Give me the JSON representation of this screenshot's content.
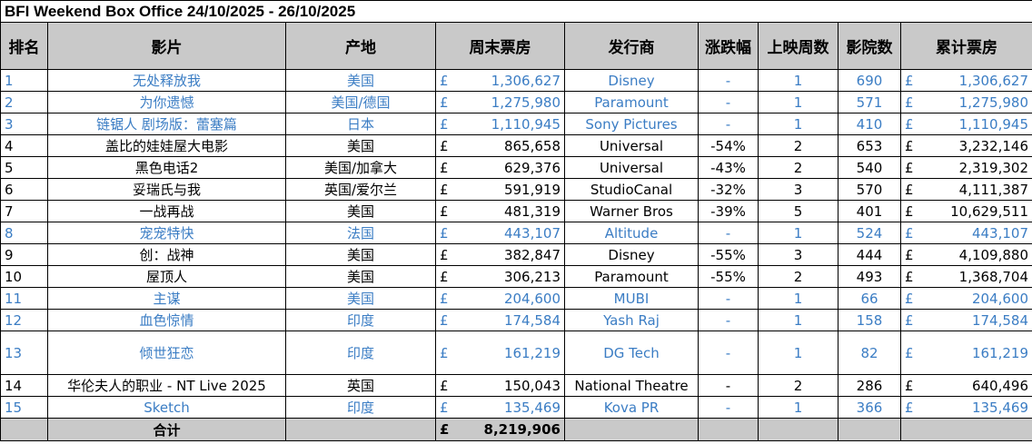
{
  "title": "BFI Weekend Box Office 24/10/2025 - 26/10/2025",
  "currency": "£",
  "headers": [
    "排名",
    "影片",
    "产地",
    "周末票房",
    "发行商",
    "涨跌幅",
    "上映周数",
    "影院数",
    "累计票房"
  ],
  "rows": [
    {
      "rank": "1",
      "film": "无处释放我",
      "origin": "美国",
      "weekend": "1,306,627",
      "distributor": "Disney",
      "change": "-",
      "weeks": "1",
      "cinemas": "690",
      "total": "1,306,627",
      "is_new": true
    },
    {
      "rank": "2",
      "film": "为你遗憾",
      "origin": "美国/德国",
      "weekend": "1,275,980",
      "distributor": "Paramount",
      "change": "-",
      "weeks": "1",
      "cinemas": "571",
      "total": "1,275,980",
      "is_new": true
    },
    {
      "rank": "3",
      "film": "链锯人 剧场版：蕾塞篇",
      "origin": "日本",
      "weekend": "1,110,945",
      "distributor": "Sony Pictures",
      "change": "-",
      "weeks": "1",
      "cinemas": "410",
      "total": "1,110,945",
      "is_new": true
    },
    {
      "rank": "4",
      "film": "盖比的娃娃屋大电影",
      "origin": "美国",
      "weekend": "865,658",
      "distributor": "Universal",
      "change": "-54%",
      "weeks": "2",
      "cinemas": "653",
      "total": "3,232,146",
      "is_new": false
    },
    {
      "rank": "5",
      "film": "黑色电话2",
      "origin": "美国/加拿大",
      "weekend": "629,376",
      "distributor": "Universal",
      "change": "-43%",
      "weeks": "2",
      "cinemas": "540",
      "total": "2,319,302",
      "is_new": false
    },
    {
      "rank": "6",
      "film": "妥瑞氏与我",
      "origin": "英国/爱尔兰",
      "weekend": "591,919",
      "distributor": "StudioCanal",
      "change": "-32%",
      "weeks": "3",
      "cinemas": "570",
      "total": "4,111,387",
      "is_new": false
    },
    {
      "rank": "7",
      "film": "一战再战",
      "origin": "美国",
      "weekend": "481,319",
      "distributor": "Warner Bros",
      "change": "-39%",
      "weeks": "5",
      "cinemas": "401",
      "total": "10,629,511",
      "is_new": false
    },
    {
      "rank": "8",
      "film": "宠宠特快",
      "origin": "法国",
      "weekend": "443,107",
      "distributor": "Altitude",
      "change": "-",
      "weeks": "1",
      "cinemas": "524",
      "total": "443,107",
      "is_new": true
    },
    {
      "rank": "9",
      "film": "创：战神",
      "origin": "美国",
      "weekend": "382,847",
      "distributor": "Disney",
      "change": "-55%",
      "weeks": "3",
      "cinemas": "444",
      "total": "4,109,880",
      "is_new": false
    },
    {
      "rank": "10",
      "film": "屋顶人",
      "origin": "美国",
      "weekend": "306,213",
      "distributor": "Paramount",
      "change": "-55%",
      "weeks": "2",
      "cinemas": "493",
      "total": "1,368,704",
      "is_new": false
    },
    {
      "rank": "11",
      "film": "主谋",
      "origin": "美国",
      "weekend": "204,600",
      "distributor": "MUBI",
      "change": "-",
      "weeks": "1",
      "cinemas": "66",
      "total": "204,600",
      "is_new": true
    },
    {
      "rank": "12",
      "film": "血色惊情",
      "origin": "印度",
      "weekend": "174,584",
      "distributor": "Yash Raj",
      "change": "-",
      "weeks": "1",
      "cinemas": "158",
      "total": "174,584",
      "is_new": true
    },
    {
      "rank": "13",
      "film": "倾世狂恋",
      "origin": "印度",
      "weekend": "161,219",
      "distributor": "DG Tech",
      "change": "-",
      "weeks": "1",
      "cinemas": "82",
      "total": "161,219",
      "is_new": true,
      "tall": true
    },
    {
      "rank": "14",
      "film": "华伦夫人的职业 - NT Live 2025",
      "origin": "英国",
      "weekend": "150,043",
      "distributor": "National Theatre",
      "change": "-",
      "weeks": "2",
      "cinemas": "286",
      "total": "640,496",
      "is_new": false
    },
    {
      "rank": "15",
      "film": "Sketch",
      "origin": "印度",
      "weekend": "135,469",
      "distributor": "Kova PR",
      "change": "-",
      "weeks": "1",
      "cinemas": "366",
      "total": "135,469",
      "is_new": true
    }
  ],
  "total_row": {
    "label": "合计",
    "weekend": "8,219,906"
  }
}
